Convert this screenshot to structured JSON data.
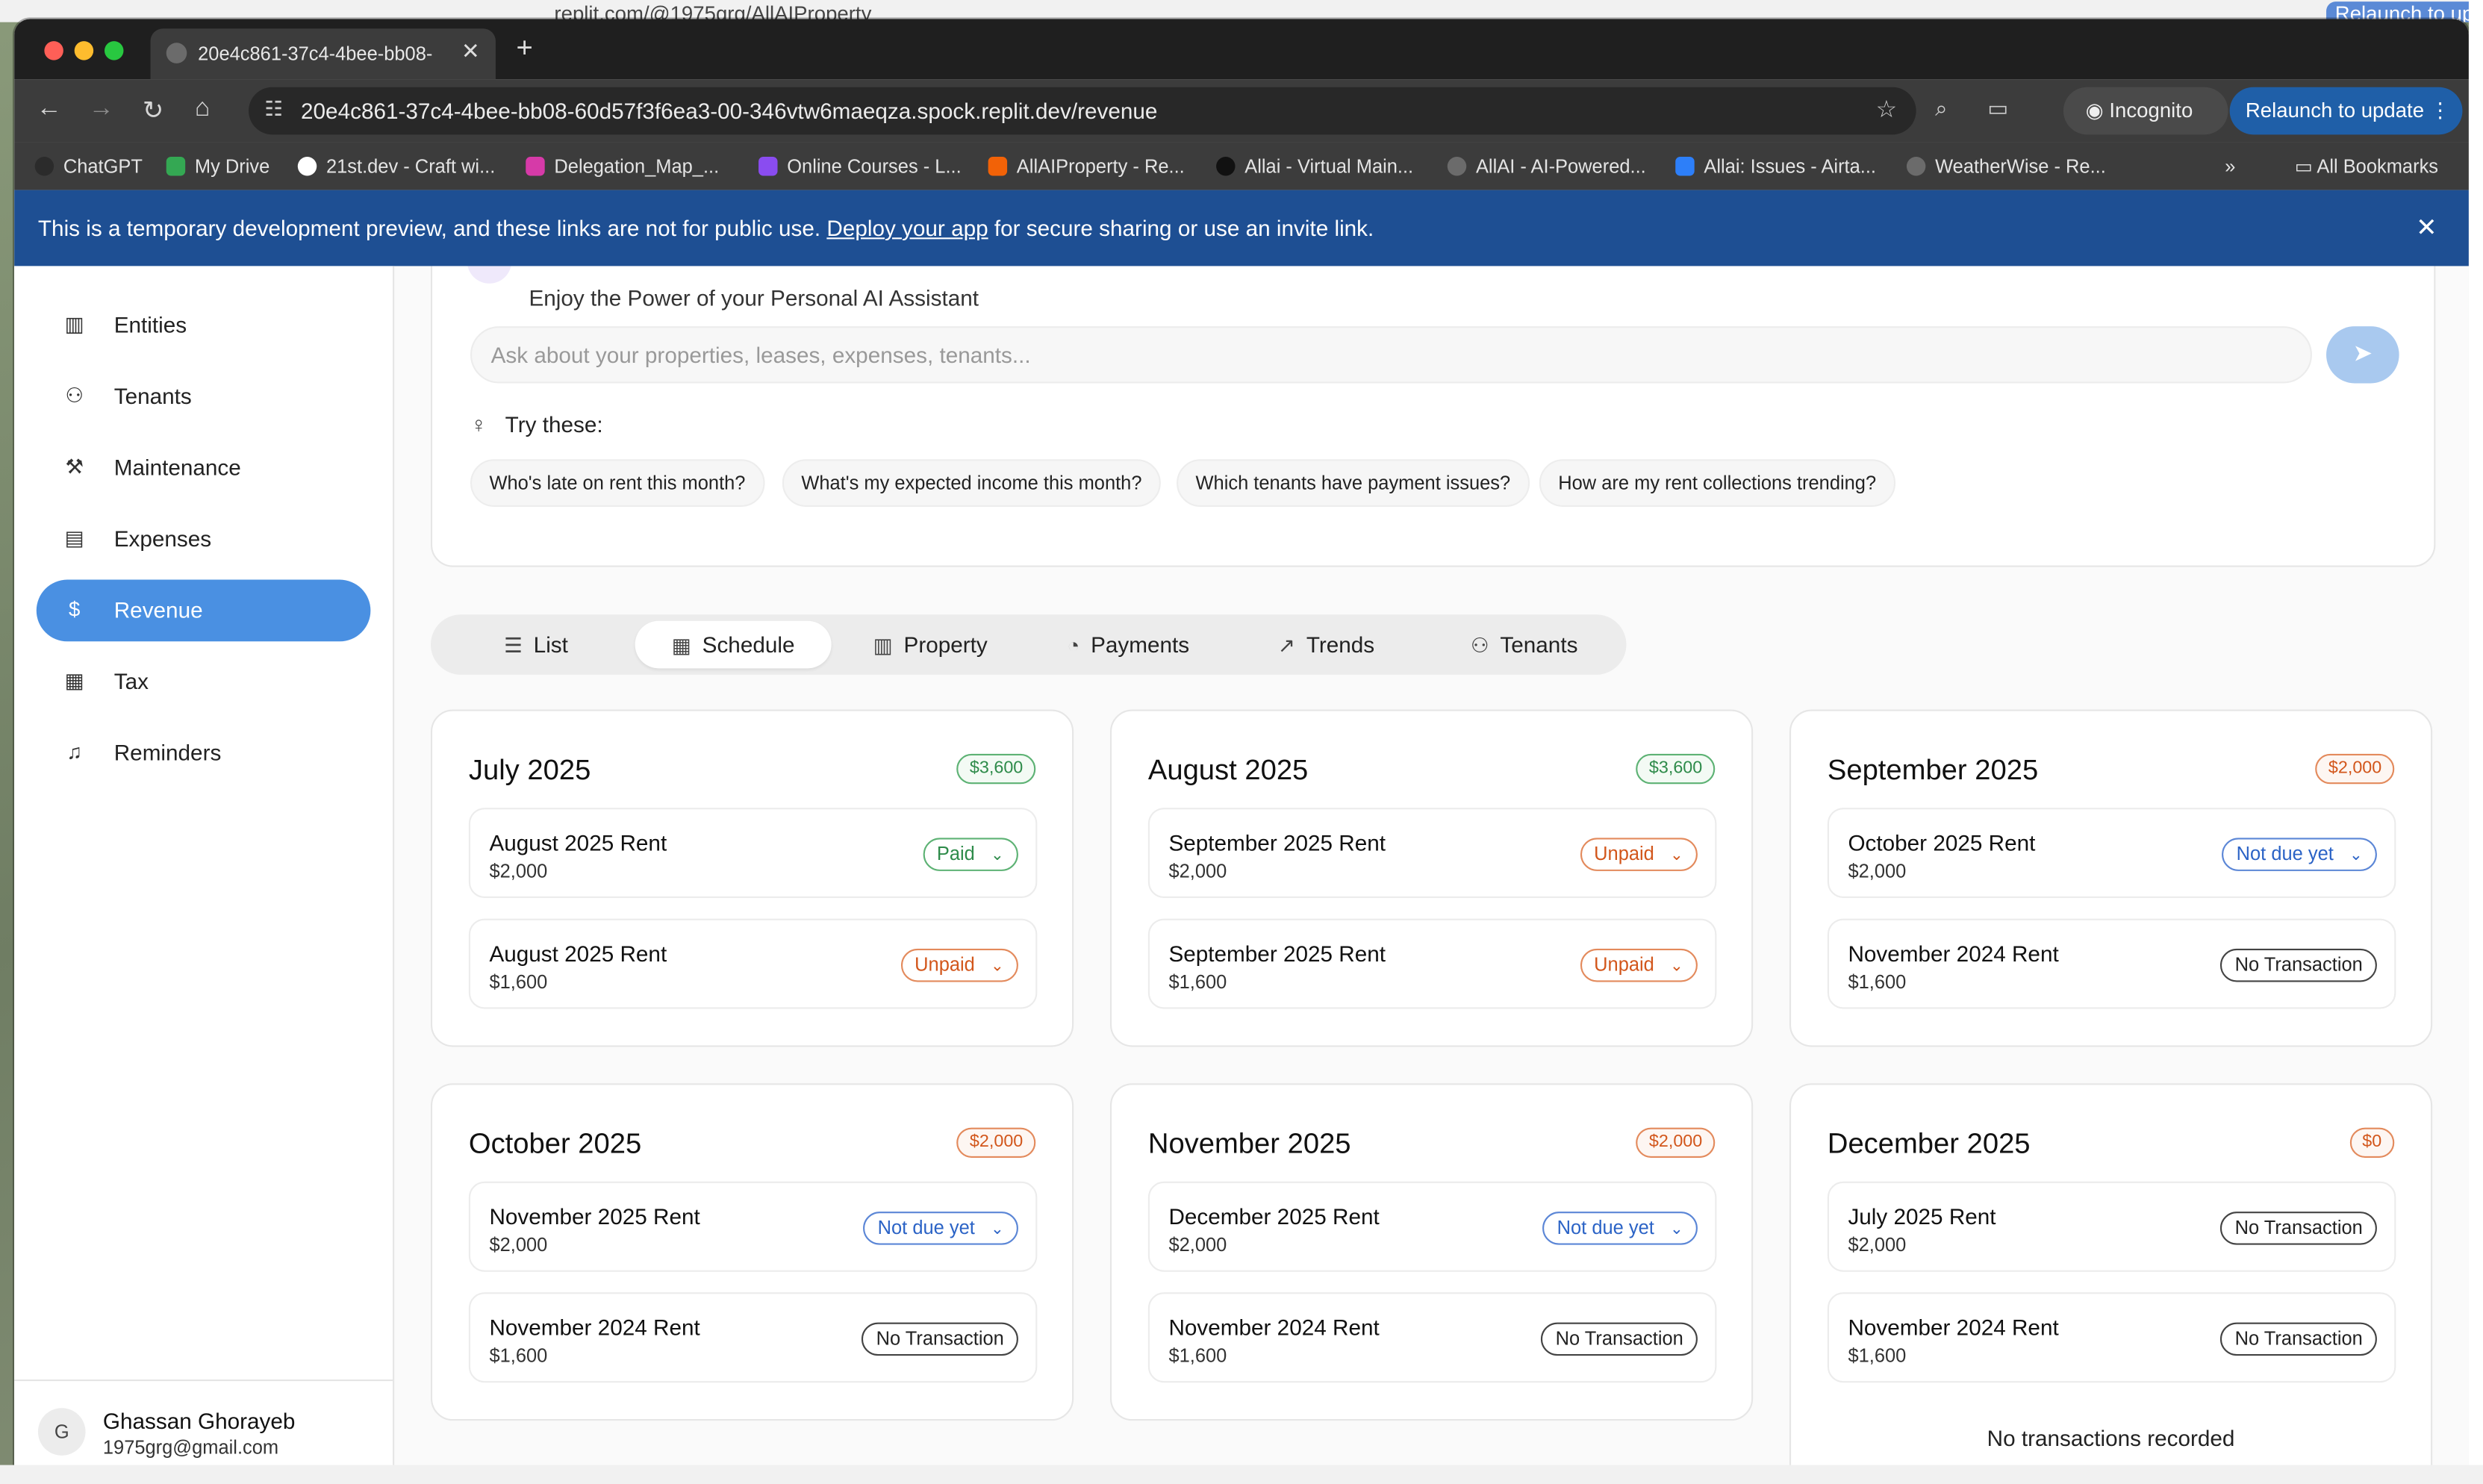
{
  "background_tab": {
    "url": "replit.com/@1975grg/AllAIProperty",
    "relaunch_fragment": "Relaunch to up"
  },
  "browser": {
    "tab_title": "20e4c861-37c4-4bee-bb08-",
    "new_tab": "+",
    "url": "20e4c861-37c4-4bee-bb08-60d57f3f6ea3-00-346vtw6maeqza.spock.replit.dev/revenue",
    "incognito_label": "Incognito",
    "relaunch_label": "Relaunch to update",
    "bookmarks": [
      {
        "label": "ChatGPT",
        "color": "#2b2b2b"
      },
      {
        "label": "My Drive",
        "color": "#34a853"
      },
      {
        "label": "21st.dev - Craft wi...",
        "color": "#ffffff"
      },
      {
        "label": "Delegation_Map_...",
        "color": "#d63aa8"
      },
      {
        "label": "Online Courses - L...",
        "color": "#8a4cf0"
      },
      {
        "label": "AllAIProperty - Re...",
        "color": "#f26207"
      },
      {
        "label": "Allai - Virtual Main...",
        "color": "#111111"
      },
      {
        "label": "AllAI - AI-Powered...",
        "color": "#6b6b6b"
      },
      {
        "label": "Allai: Issues - Airta...",
        "color": "#2d7ff9"
      },
      {
        "label": "WeatherWise - Re...",
        "color": "#6b6b6b"
      }
    ],
    "more_bookmarks": "»",
    "all_bookmarks": "All Bookmarks"
  },
  "banner": {
    "text_before": "This is a temporary development preview, and these links are not for public use. ",
    "link": "Deploy your app",
    "text_after": " for secure sharing or use an invite link.",
    "close": "✕"
  },
  "sidebar": {
    "items": [
      {
        "label": "Entities",
        "icon": "building-icon",
        "glyph": "▥"
      },
      {
        "label": "Tenants",
        "icon": "users-icon",
        "glyph": "⚇"
      },
      {
        "label": "Maintenance",
        "icon": "wrench-icon",
        "glyph": "⚒"
      },
      {
        "label": "Expenses",
        "icon": "receipt-icon",
        "glyph": "▤"
      },
      {
        "label": "Revenue",
        "icon": "dollar-icon",
        "glyph": "$"
      },
      {
        "label": "Tax",
        "icon": "calculator-icon",
        "glyph": "▦"
      },
      {
        "label": "Reminders",
        "icon": "bell-icon",
        "glyph": "♫"
      }
    ],
    "active": "Revenue",
    "user": {
      "initial": "G",
      "name": "Ghassan Ghorayeb",
      "email": "1975grg@gmail.com"
    }
  },
  "assistant": {
    "subtitle": "Enjoy the Power of your Personal AI Assistant",
    "placeholder": "Ask about your properties, leases, expenses, tenants...",
    "try_label": "Try these:",
    "suggestions": [
      "Who's late on rent this month?",
      "What's my expected income this month?",
      "Which tenants have payment issues?",
      "How are my rent collections trending?"
    ]
  },
  "view_tabs": [
    {
      "label": "List",
      "glyph": "☰"
    },
    {
      "label": "Schedule",
      "glyph": "▦"
    },
    {
      "label": "Property",
      "glyph": "▥"
    },
    {
      "label": "Payments",
      "glyph": "◔"
    },
    {
      "label": "Trends",
      "glyph": "↗"
    },
    {
      "label": "Tenants",
      "glyph": "⚇"
    }
  ],
  "active_view": "Schedule",
  "colors": {
    "accent": "#4a90e2",
    "paid": "#2e8b4a",
    "unpaid": "#d2561b",
    "not_due": "#2b63c6"
  },
  "months": [
    {
      "title": "July 2025",
      "total": "$3,600",
      "total_tone": "green",
      "items": [
        {
          "label": "August 2025 Rent",
          "amount": "$2,000",
          "status": "Paid",
          "tone": "paid",
          "dropdown": true
        },
        {
          "label": "August 2025 Rent",
          "amount": "$1,600",
          "status": "Unpaid",
          "tone": "unpaid",
          "dropdown": true
        }
      ]
    },
    {
      "title": "August 2025",
      "total": "$3,600",
      "total_tone": "green",
      "items": [
        {
          "label": "September 2025 Rent",
          "amount": "$2,000",
          "status": "Unpaid",
          "tone": "unpaid",
          "dropdown": true
        },
        {
          "label": "September 2025 Rent",
          "amount": "$1,600",
          "status": "Unpaid",
          "tone": "unpaid",
          "dropdown": true
        }
      ]
    },
    {
      "title": "September 2025",
      "total": "$2,000",
      "total_tone": "orange",
      "items": [
        {
          "label": "October 2025 Rent",
          "amount": "$2,000",
          "status": "Not due yet",
          "tone": "notdue",
          "dropdown": true
        },
        {
          "label": "November 2024 Rent",
          "amount": "$1,600",
          "status": "No Transaction",
          "tone": "notx",
          "dropdown": false
        }
      ]
    },
    {
      "title": "October 2025",
      "total": "$2,000",
      "total_tone": "orange",
      "items": [
        {
          "label": "November 2025 Rent",
          "amount": "$2,000",
          "status": "Not due yet",
          "tone": "notdue",
          "dropdown": true
        },
        {
          "label": "November 2024 Rent",
          "amount": "$1,600",
          "status": "No Transaction",
          "tone": "notx",
          "dropdown": false
        }
      ]
    },
    {
      "title": "November 2025",
      "total": "$2,000",
      "total_tone": "orange",
      "items": [
        {
          "label": "December 2025 Rent",
          "amount": "$2,000",
          "status": "Not due yet",
          "tone": "notdue",
          "dropdown": true
        },
        {
          "label": "November 2024 Rent",
          "amount": "$1,600",
          "status": "No Transaction",
          "tone": "notx",
          "dropdown": false
        }
      ]
    },
    {
      "title": "December 2025",
      "total": "$0",
      "total_tone": "orange",
      "items": [
        {
          "label": "July 2025 Rent",
          "amount": "$2,000",
          "status": "No Transaction",
          "tone": "notx",
          "dropdown": false
        },
        {
          "label": "November 2024 Rent",
          "amount": "$1,600",
          "status": "No Transaction",
          "tone": "notx",
          "dropdown": false
        }
      ],
      "footer": "No transactions recorded"
    }
  ]
}
